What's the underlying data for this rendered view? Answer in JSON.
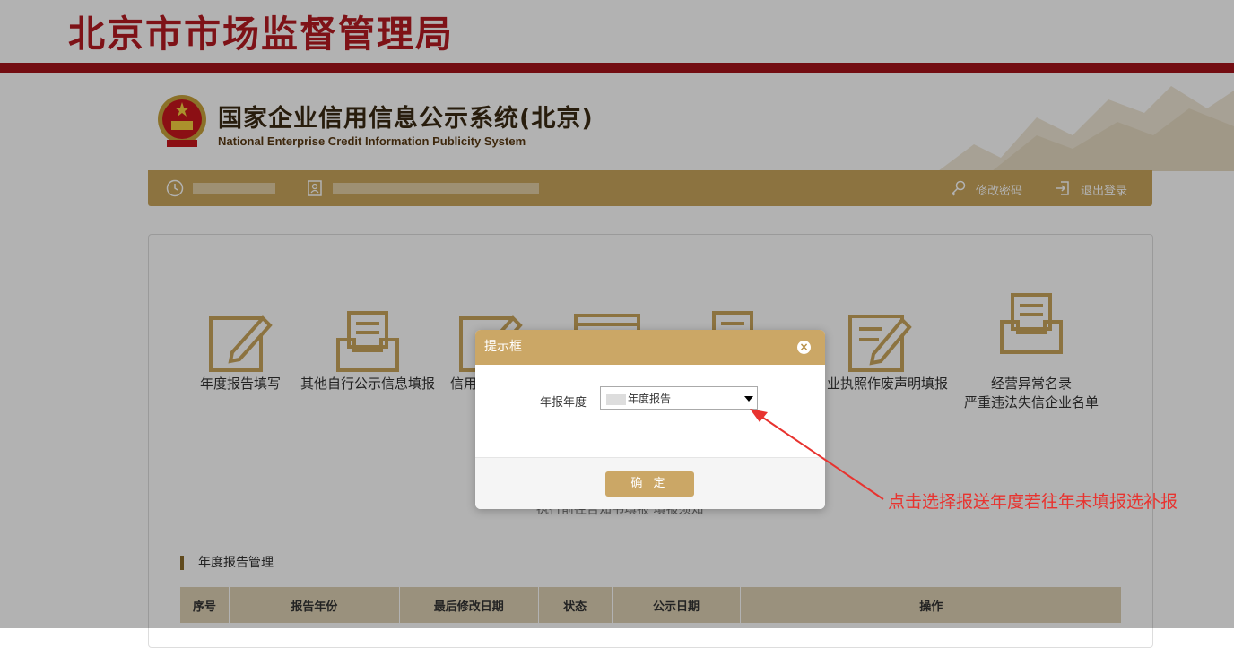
{
  "agency_title": "北京市市场监督管理局",
  "system": {
    "title": "国家企业信用信息公示系统(北京)",
    "subtitle": "National Enterprise Credit Information Publicity System"
  },
  "user_bar": {
    "change_password": "修改密码",
    "logout": "退出登录"
  },
  "functions": [
    {
      "label": "年度报告填写",
      "icon": "edit-document-icon"
    },
    {
      "label": "其他自行公示信息填报",
      "icon": "inbox-document-icon"
    },
    {
      "label": "信用",
      "icon": "edit-document-icon"
    },
    {
      "label": "",
      "icon": "browser-window-icon"
    },
    {
      "label": "",
      "icon": "inbox-document-icon"
    },
    {
      "label": "业执照作废声明填报",
      "icon": "edit-document-icon"
    },
    {
      "label_line1": "经营异常名录",
      "label_line2": "严重违法失信企业名单",
      "icon": "inbox-document-icon"
    }
  ],
  "behind_text": "执行前往告知书填报   填报须知",
  "section_title": "年度报告管理",
  "table": {
    "columns": [
      "序号",
      "报告年份",
      "最后修改日期",
      "状态",
      "公示日期",
      "操作"
    ]
  },
  "dialog": {
    "title": "提示框",
    "close": "×",
    "field_label": "年报年度",
    "select_value": "年度报告",
    "ok_label": "确 定"
  },
  "annotation": "点击选择报送年度若往年未填报选补报",
  "colors": {
    "brand_red": "#a5141a",
    "gold": "#c9a55c",
    "annotation_red": "#e8332f"
  }
}
